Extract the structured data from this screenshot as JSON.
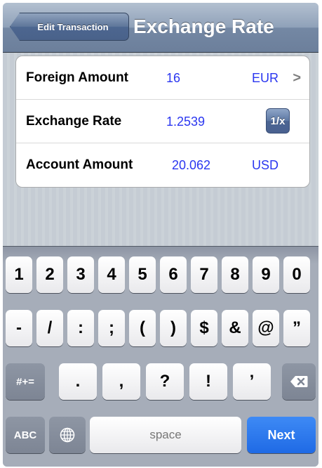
{
  "navbar": {
    "back_label": "Edit Transaction",
    "title": "Exchange Rate"
  },
  "rows": [
    {
      "label": "Foreign Amount",
      "value": "16",
      "unit": "EUR",
      "accessory": ">"
    },
    {
      "label": "Exchange Rate",
      "value": "1.2539",
      "button": "1/x"
    },
    {
      "label": "Account Amount",
      "value": "20.062",
      "unit": "USD"
    }
  ],
  "keyboard": {
    "row1": [
      "1",
      "2",
      "3",
      "4",
      "5",
      "6",
      "7",
      "8",
      "9",
      "0"
    ],
    "row2": [
      "-",
      "/",
      ":",
      ";",
      "(",
      ")",
      "$",
      "&",
      "@",
      "”"
    ],
    "row3": [
      ".",
      ",",
      "?",
      "!",
      "’"
    ],
    "mode_key": "#+=",
    "delete_icon": "delete-backward-icon",
    "abc_key": "ABC",
    "globe_icon": "globe-icon",
    "space_key": "space",
    "next_key": "Next"
  },
  "colors": {
    "accent_blue": "#2a36f0",
    "next_key": "#1f6ae5",
    "navbar": "#6c7f9b"
  }
}
